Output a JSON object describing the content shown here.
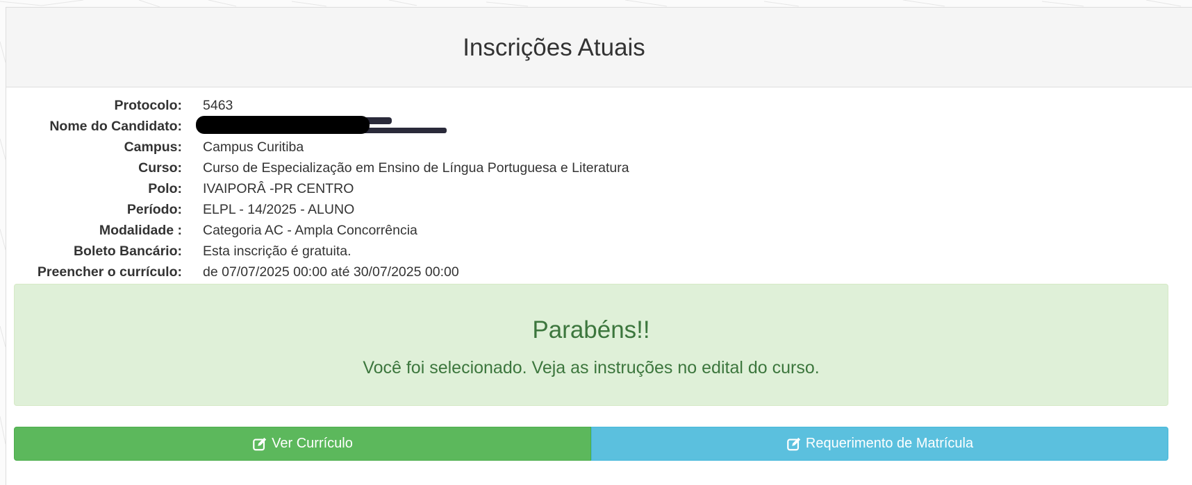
{
  "panel": {
    "title": "Inscrições Atuais"
  },
  "info": {
    "rows": [
      {
        "label": "Protocolo:",
        "value": "5463"
      },
      {
        "label": "Nome do Candidato:",
        "value": "",
        "redacted": true
      },
      {
        "label": "Campus:",
        "value": "Campus Curitiba"
      },
      {
        "label": "Curso:",
        "value": "Curso de Especialização em Ensino de Língua Portuguesa e Literatura"
      },
      {
        "label": "Polo:",
        "value": "IVAIPORÂ -PR CENTRO"
      },
      {
        "label": "Período:",
        "value": "ELPL - 14/2025 - ALUNO"
      },
      {
        "label": "Modalidade :",
        "value": "Categoria AC - Ampla Concorrência"
      },
      {
        "label": "Boleto Bancário:",
        "value": "Esta inscrição é gratuita."
      },
      {
        "label": "Preencher o currículo:",
        "value": "de 07/07/2025 00:00 até 30/07/2025 00:00"
      }
    ]
  },
  "alert": {
    "title": "Parabéns!!",
    "message": "Você foi selecionado. Veja as instruções no edital do curso."
  },
  "buttons": {
    "ver_curriculo": "Ver Currículo",
    "requerimento": "Requerimento de Matrícula",
    "icon": "edit-icon"
  },
  "colors": {
    "success": "#5cb85c",
    "info": "#5bc0de",
    "alert_bg": "#dff0d8",
    "alert_text": "#3c763d"
  }
}
